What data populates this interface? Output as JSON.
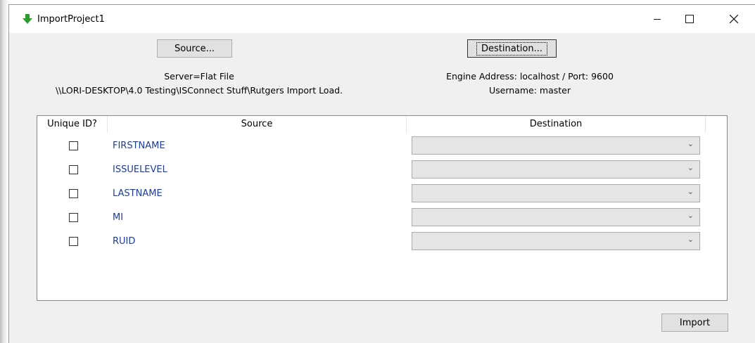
{
  "window": {
    "title": "ImportProject1"
  },
  "buttons": {
    "source": "Source...",
    "destination": "Destination...",
    "import": "Import"
  },
  "source_info": {
    "server": "Server=Flat File",
    "path": "\\\\LORI-DESKTOP\\4.0 Testing\\ISConnect Stuff\\Rutgers Import Load."
  },
  "destination_info": {
    "engine": "Engine Address: localhost / Port: 9600",
    "username": "Username: master"
  },
  "grid": {
    "headers": [
      "Unique ID?",
      "Source",
      "Destination"
    ],
    "rows": [
      {
        "unique": false,
        "source": "FIRSTNAME",
        "destination": ""
      },
      {
        "unique": false,
        "source": "ISSUELEVEL",
        "destination": ""
      },
      {
        "unique": false,
        "source": "LASTNAME",
        "destination": ""
      },
      {
        "unique": false,
        "source": "MI",
        "destination": ""
      },
      {
        "unique": false,
        "source": "RUID",
        "destination": ""
      }
    ]
  },
  "icons": {
    "app": "green-down-arrow-icon",
    "combo_arrow": "chevron-down-icon"
  },
  "colors": {
    "field_text": "#1f3d8f",
    "app_icon": "#2e9b2e"
  }
}
